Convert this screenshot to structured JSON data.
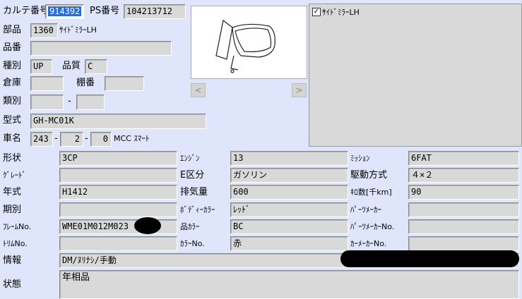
{
  "header": {
    "karte_label": "カルテ番号",
    "karte_value": "914392",
    "ps_label": "PS番号",
    "ps_value": "104213712",
    "part_label": "部品",
    "part_code": "1360",
    "part_name": "ｻｲﾄﾞﾐﾗｰLH",
    "partno_label": "品番",
    "partno_value": "",
    "type_label": "種別",
    "type_value": "UP",
    "quality_label": "品質",
    "quality_value": "C",
    "warehouse_label": "倉庫",
    "warehouse_value": "",
    "shelf_label": "棚番",
    "shelf_value": "",
    "class_label": "類別",
    "class_value1": "",
    "class_sep": "-",
    "class_value2": "",
    "model_label": "型式",
    "model_value": "GH-MC01K",
    "car_label": "車名",
    "car_v1": "243",
    "car_v2": "2",
    "car_v3": "0",
    "car_sep": "-",
    "car_name": "MCC ｽﾏｰﾄ"
  },
  "image": {
    "prev_label": "<",
    "next_label": ">",
    "icon": "side-mirror-drawing"
  },
  "panel": {
    "checkbox_checked": true,
    "checkbox_label": "ｻｲﾄﾞﾐﾗｰLH"
  },
  "details": {
    "rows": [
      {
        "l1": "形状",
        "v1": "3CP",
        "l2": "ｴﾝｼﾞﾝ",
        "v2": "13",
        "l3": "ﾐｯｼｮﾝ",
        "v3": "6FAT"
      },
      {
        "l1": "ｸﾞﾚｰﾄﾞ",
        "v1": "",
        "l2": "E区分",
        "v2": "ガソリン",
        "l3": "駆動方式",
        "v3": "４×２"
      },
      {
        "l1": "年式",
        "v1": "H1412",
        "l2": "排気量",
        "v2": "600",
        "l3": "ｷﾛ数[千km]",
        "v3": "90"
      },
      {
        "l1": "期別",
        "v1": "",
        "l2": "ﾎﾞﾃﾞｨｰｶﾗｰ",
        "v2": "ﾚｯﾄﾞ",
        "l3": "ﾊﾟｰﾂﾒｰｶｰ",
        "v3": ""
      },
      {
        "l1": "ﾌﾚｰﾑNo.",
        "v1": "WME01M012M023",
        "l2": "品ｶﾗｰ",
        "v2": "BC",
        "l3": "ﾊﾟｰﾂﾒｰｶｰNo.",
        "v3": ""
      },
      {
        "l1": "ﾄﾘﾑNo.",
        "v1": "",
        "l2": "ｶﾗｰNo.",
        "v2": "赤",
        "l3": "ｶｰﾒｰｶｰNo.",
        "v3": ""
      }
    ],
    "info_label": "情報",
    "info_value": "DM/ﾇﾘﾅｼ/手動",
    "state_label": "状態",
    "state_value": "年相品"
  }
}
